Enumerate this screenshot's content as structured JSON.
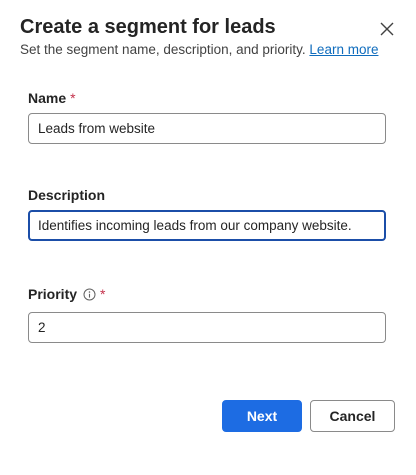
{
  "dialog": {
    "title": "Create a segment for leads",
    "subtitle": "Set the segment name, description, and priority.",
    "learn_more": "Learn more",
    "close_icon": "close-icon"
  },
  "fields": {
    "name": {
      "label": "Name",
      "required_mark": "*",
      "value": "Leads from website"
    },
    "description": {
      "label": "Description",
      "value": "Identifies incoming leads from our company website."
    },
    "priority": {
      "label": "Priority",
      "required_mark": "*",
      "value": "2",
      "info_icon": "info-icon"
    }
  },
  "actions": {
    "next": "Next",
    "cancel": "Cancel"
  },
  "colors": {
    "primary": "#1d6ce3",
    "link": "#0f6cbd",
    "required": "#c4314b",
    "focus_border": "#1b4ea8"
  }
}
